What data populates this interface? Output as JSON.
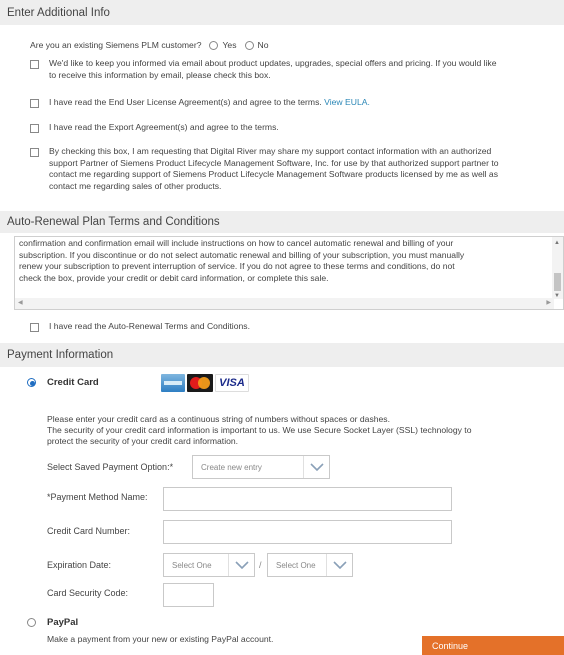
{
  "additional_info": {
    "header": "Enter Additional Info",
    "question": "Are you an existing Siemens PLM customer?",
    "yes_label": "Yes",
    "no_label": "No",
    "checks": [
      {
        "text_line1": "We'd like to keep you informed via email about product updates, upgrades, special offers and pricing. If you would like",
        "text_line2": "to receive this information by email, please check this box."
      },
      {
        "text": "I have read the End User License Agreement(s) and agree to the terms.",
        "link": "View EULA."
      },
      {
        "text": "I have read the Export Agreement(s) and agree to the terms."
      },
      {
        "line1": "By checking this box, I am requesting that Digital River may share my support contact information with an authorized",
        "line2": "support Partner of Siemens Product Lifecycle Management Software, Inc. for use by that authorized support partner to",
        "line3": "contact me regarding support of Siemens Product Lifecycle Management Software products licensed by me as well as",
        "line4": "contact me regarding sales of other products."
      }
    ]
  },
  "auto_renewal": {
    "header": "Auto-Renewal Plan Terms and Conditions",
    "terms_lines": [
      "confirmation and confirmation email will include instructions on how to cancel automatic renewal and billing of your",
      "subscription. If you discontinue or do not select automatic renewal and billing of your subscription, you must manually",
      "renew your subscription to prevent interruption of service. If you do not agree to these terms and conditions, do not",
      "check the box, provide your credit or debit card information, or complete this sale."
    ],
    "agree_label": "I have read the Auto-Renewal Terms and Conditions."
  },
  "payment": {
    "header": "Payment Information",
    "credit_card_label": "Credit Card",
    "visa_label": "VISA",
    "instructions_line1": "Please enter your credit card as a continuous string of numbers without spaces or dashes.",
    "instructions_line2": "The security of your credit card information is important to us. We use Secure Socket Layer (SSL) technology to",
    "instructions_line3": "protect the security of your credit card information.",
    "saved_option_label": "Select Saved Payment Option:*",
    "saved_option_value": "Create new entry",
    "method_name_label": "*Payment Method Name:",
    "method_name_value": "",
    "card_number_label": "Credit Card Number:",
    "card_number_value": "",
    "expiration_label": "Expiration Date:",
    "exp_month_value": "Select One",
    "exp_separator": "/",
    "exp_year_value": "Select One",
    "security_code_label": "Card Security Code:",
    "security_code_value": "",
    "paypal_label": "PayPal",
    "paypal_desc": "Make a payment from your new or existing PayPal account.",
    "continue_label": "Continue"
  },
  "colors": {
    "accent_orange": "#e47129",
    "link_blue": "#2b87b6",
    "radio_blue": "#1f6dc1"
  }
}
